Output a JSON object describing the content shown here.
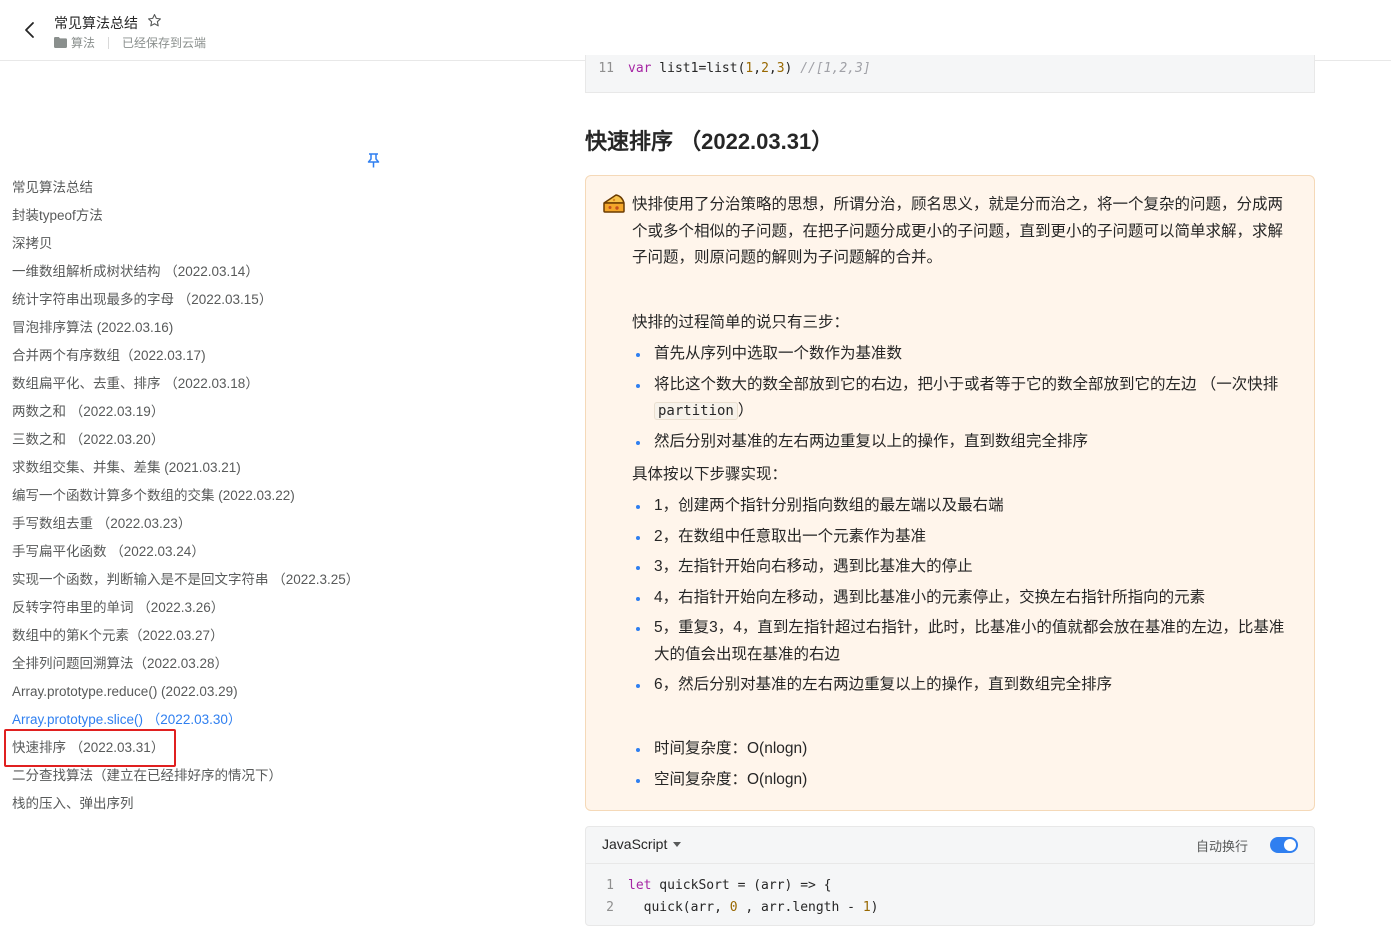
{
  "header": {
    "title": "常见算法总结",
    "folder": "算法",
    "save_status": "已经保存到云端"
  },
  "toc": {
    "items": [
      "常见算法总结",
      "封装typeof方法",
      "深拷贝",
      "一维数组解析成树状结构 （2022.03.14）",
      "统计字符串出现最多的字母 （2022.03.15）",
      "冒泡排序算法 (2022.03.16)",
      "合并两个有序数组（2022.03.17)",
      "数组扁平化、去重、排序 （2022.03.18）",
      "两数之和 （2022.03.19）",
      "三数之和 （2022.03.20）",
      "求数组交集、并集、差集 (2021.03.21)",
      "编写一个函数计算多个数组的交集 (2022.03.22)",
      "手写数组去重 （2022.03.23）",
      "手写扁平化函数 （2022.03.24）",
      "实现一个函数，判断输入是不是回文字符串 （2022.3.25）",
      "反转字符串里的单词 （2022.3.26）",
      "数组中的第K个元素（2022.03.27）",
      "全排列问题回溯算法（2022.03.28）",
      "Array.prototype.reduce() (2022.03.29)",
      "Array.prototype.slice() （2022.03.30）",
      "快速排序 （2022.03.31）",
      "二分查找算法（建立在已经排好序的情况下）",
      "栈的压入、弹出序列"
    ]
  },
  "prev_code": {
    "line_no": "11",
    "kw": "var",
    "text1": " list1=list(",
    "n1": "1",
    "c1": ",",
    "n2": "2",
    "c2": ",",
    "n3": "3",
    "text2": ") ",
    "comment": "//[1,2,3]"
  },
  "section": {
    "title": "快速排序 （2022.03.31）"
  },
  "callout": {
    "intro": "快排使用了分治策略的思想，所谓分治，顾名思义，就是分而治之，将一个复杂的问题，分成两个或多个相似的子问题，在把子问题分成更小的子问题，直到更小的子问题可以简单求解，求解子问题，则原问题的解则为子问题解的合并。",
    "steps_heading": "快排的过程简单的说只有三步：",
    "steps": [
      "首先从序列中选取一个数作为基准数",
      "将比这个数大的数全部放到它的右边，把小于或者等于它的数全部放到它的左边 （一次快排",
      "然后分别对基准的左右两边重复以上的操作，直到数组完全排序"
    ],
    "partition_code": "partition",
    "partition_close": "）",
    "impl_heading": "具体按以下步骤实现：",
    "impl_steps": [
      "1，创建两个指针分别指向数组的最左端以及最右端",
      "2，在数组中任意取出一个元素作为基准",
      "3，左指针开始向右移动，遇到比基准大的停止",
      "4，右指针开始向左移动，遇到比基准小的元素停止，交换左右指针所指向的元素",
      "5，重复3，4，直到左指针超过右指针，此时，比基准小的值就都会放在基准的左边，比基准大的值会出现在基准的右边",
      "6，然后分别对基准的左右两边重复以上的操作，直到数组完全排序"
    ],
    "complexity": [
      "时间复杂度：O(nlogn)",
      "空间复杂度：O(nlogn)"
    ]
  },
  "code_block": {
    "language": "JavaScript",
    "wrap_label": "自动换行",
    "wrap_enabled": true,
    "lines": [
      {
        "no": "1",
        "kw": "let",
        "rest": " quickSort = (arr) => {"
      },
      {
        "no": "2",
        "pre": "  quick(arr, ",
        "num1": "0",
        "mid": " , arr.length - ",
        "num2": "1",
        "post": ")"
      }
    ]
  },
  "colors": {
    "accent": "#2f7ff0",
    "callout_bg": "#fff5eb",
    "highlight_box": "#e02020"
  }
}
